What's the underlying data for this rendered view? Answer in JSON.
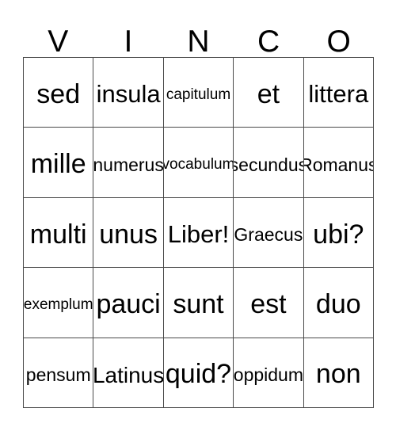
{
  "card": {
    "header": {
      "letters": [
        "V",
        "I",
        "N",
        "C",
        "O"
      ],
      "word": "VINCO"
    },
    "grid": {
      "columns": 5,
      "rows": 5,
      "cells": [
        [
          {
            "text": "sed",
            "size": "xxl"
          },
          {
            "text": "insula",
            "size": "xl"
          },
          {
            "text": "capitulum",
            "size": "s"
          },
          {
            "text": "et",
            "size": "xxl"
          },
          {
            "text": "littera",
            "size": "xl"
          }
        ],
        [
          {
            "text": "mille",
            "size": "xxl"
          },
          {
            "text": "numerus",
            "size": "m"
          },
          {
            "text": "vocabulum",
            "size": "s"
          },
          {
            "text": "secundus",
            "size": "m"
          },
          {
            "text": "Romanus",
            "size": "m"
          }
        ],
        [
          {
            "text": "multi",
            "size": "xxl"
          },
          {
            "text": "unus",
            "size": "xxl"
          },
          {
            "text": "Liber!",
            "size": "xl"
          },
          {
            "text": "Graecus",
            "size": "m"
          },
          {
            "text": "ubi?",
            "size": "xxl"
          }
        ],
        [
          {
            "text": "exemplum",
            "size": "s"
          },
          {
            "text": "pauci",
            "size": "xxl"
          },
          {
            "text": "sunt",
            "size": "xxl"
          },
          {
            "text": "est",
            "size": "xxl"
          },
          {
            "text": "duo",
            "size": "xxl"
          }
        ],
        [
          {
            "text": "pensum",
            "size": "m"
          },
          {
            "text": "Latinus",
            "size": "l"
          },
          {
            "text": "quid?",
            "size": "xxl"
          },
          {
            "text": "oppidum",
            "size": "m"
          },
          {
            "text": "non",
            "size": "xxl"
          }
        ]
      ]
    },
    "colors": {
      "background": "#ffffff",
      "text": "#000000",
      "border": "#4a4a4a"
    }
  }
}
